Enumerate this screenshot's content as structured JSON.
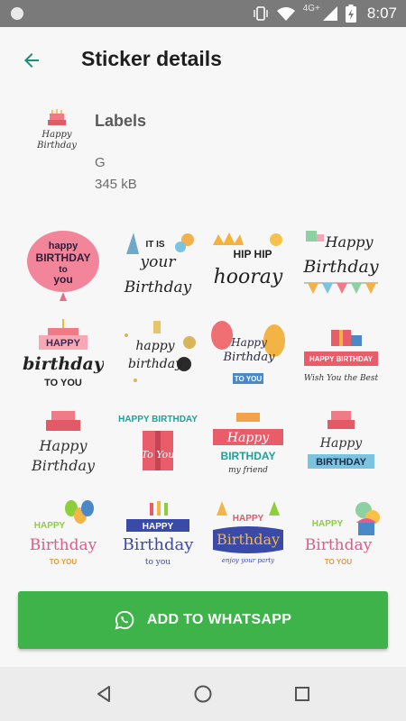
{
  "status_bar": {
    "time": "8:07",
    "network": "4G+",
    "icons": [
      "notification-dot-icon",
      "vibrate-icon",
      "wifi-icon",
      "signal-icon",
      "battery-charging-icon"
    ]
  },
  "app_bar": {
    "title": "Sticker details",
    "back_icon": "arrow-back-icon"
  },
  "pack": {
    "name": "Labels",
    "publisher": "G",
    "size": "345 kB",
    "thumb_text_1": "Happy",
    "thumb_text_2": "Birthday"
  },
  "stickers": [
    {
      "line1": "happy",
      "line2": "BIRTHDAY",
      "line3": "to",
      "line4": "you"
    },
    {
      "line1": "IT IS",
      "line2": "your",
      "line3": "Birthday"
    },
    {
      "line1": "HIP HIP",
      "line2": "hooray"
    },
    {
      "line1": "Happy",
      "line2": "Birthday"
    },
    {
      "line1": "HAPPY",
      "line2": "birthday",
      "line3": "TO YOU"
    },
    {
      "line1": "happy",
      "line2": "birthday"
    },
    {
      "line1": "Happy",
      "line2": "Birthday",
      "line3": "TO YOU"
    },
    {
      "line1": "HAPPY BIRTHDAY",
      "line2": "Wish You the Best"
    },
    {
      "line1": "Happy",
      "line2": "Birthday"
    },
    {
      "line1": "HAPPY BIRTHDAY",
      "line2": "To You"
    },
    {
      "line1": "Happy",
      "line2": "BIRTHDAY",
      "line3": "my friend"
    },
    {
      "line1": "Happy",
      "line2": "BIRTHDAY"
    },
    {
      "line1": "HAPPY",
      "line2": "Birthday",
      "line3": "TO YOU"
    },
    {
      "line1": "HAPPY",
      "line2": "Birthday",
      "line3": "to you"
    },
    {
      "line1": "HAPPY",
      "line2": "Birthday",
      "line3": "enjoy your party"
    },
    {
      "line1": "HAPPY",
      "line2": "Birthday",
      "line3": "TO YOU"
    }
  ],
  "footer": {
    "button_label": "ADD TO WHATSAPP",
    "button_icon": "whatsapp-icon",
    "button_color": "#3db34a"
  },
  "nav_bar": {
    "back": "nav-back-icon",
    "home": "nav-home-icon",
    "recents": "nav-recents-icon"
  },
  "colors": {
    "accent": "#1a8f73",
    "button": "#3db34a",
    "status_bar": "#7a7a7a"
  }
}
